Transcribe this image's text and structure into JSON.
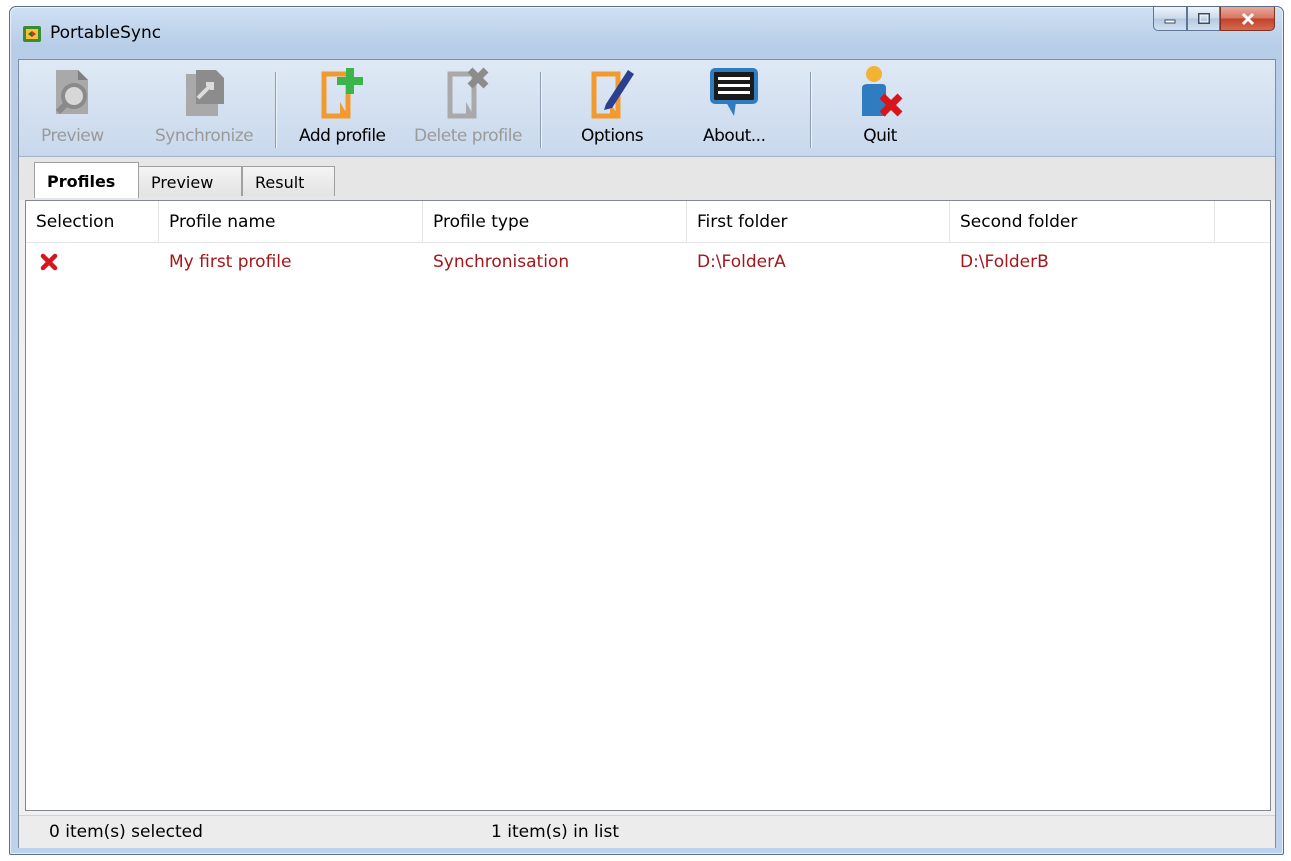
{
  "window": {
    "title": "PortableSync"
  },
  "toolbar": {
    "preview_label": "Preview",
    "synchronize_label": "Synchronize",
    "add_profile_label": "Add profile",
    "delete_profile_label": "Delete profile",
    "options_label": "Options",
    "about_label": "About...",
    "quit_label": "Quit"
  },
  "tabs": [
    {
      "label": "Profiles"
    },
    {
      "label": "Preview"
    },
    {
      "label": "Result"
    }
  ],
  "table": {
    "columns": [
      "Selection",
      "Profile name",
      "Profile type",
      "First folder",
      "Second folder"
    ],
    "rows": [
      {
        "selected": "x-mark-icon",
        "name": "My first profile",
        "type": "Synchronisation",
        "first": "D:\\FolderA",
        "second": "D:\\FolderB"
      }
    ]
  },
  "status": {
    "selected": "0 item(s) selected",
    "count": "1 item(s) in list"
  },
  "colors": {
    "row_text": "#a5161a",
    "accent_orange": "#f29a2e",
    "accent_green": "#3cb44b",
    "accent_blue": "#2f7cc1",
    "close_red": "#c0412a"
  }
}
